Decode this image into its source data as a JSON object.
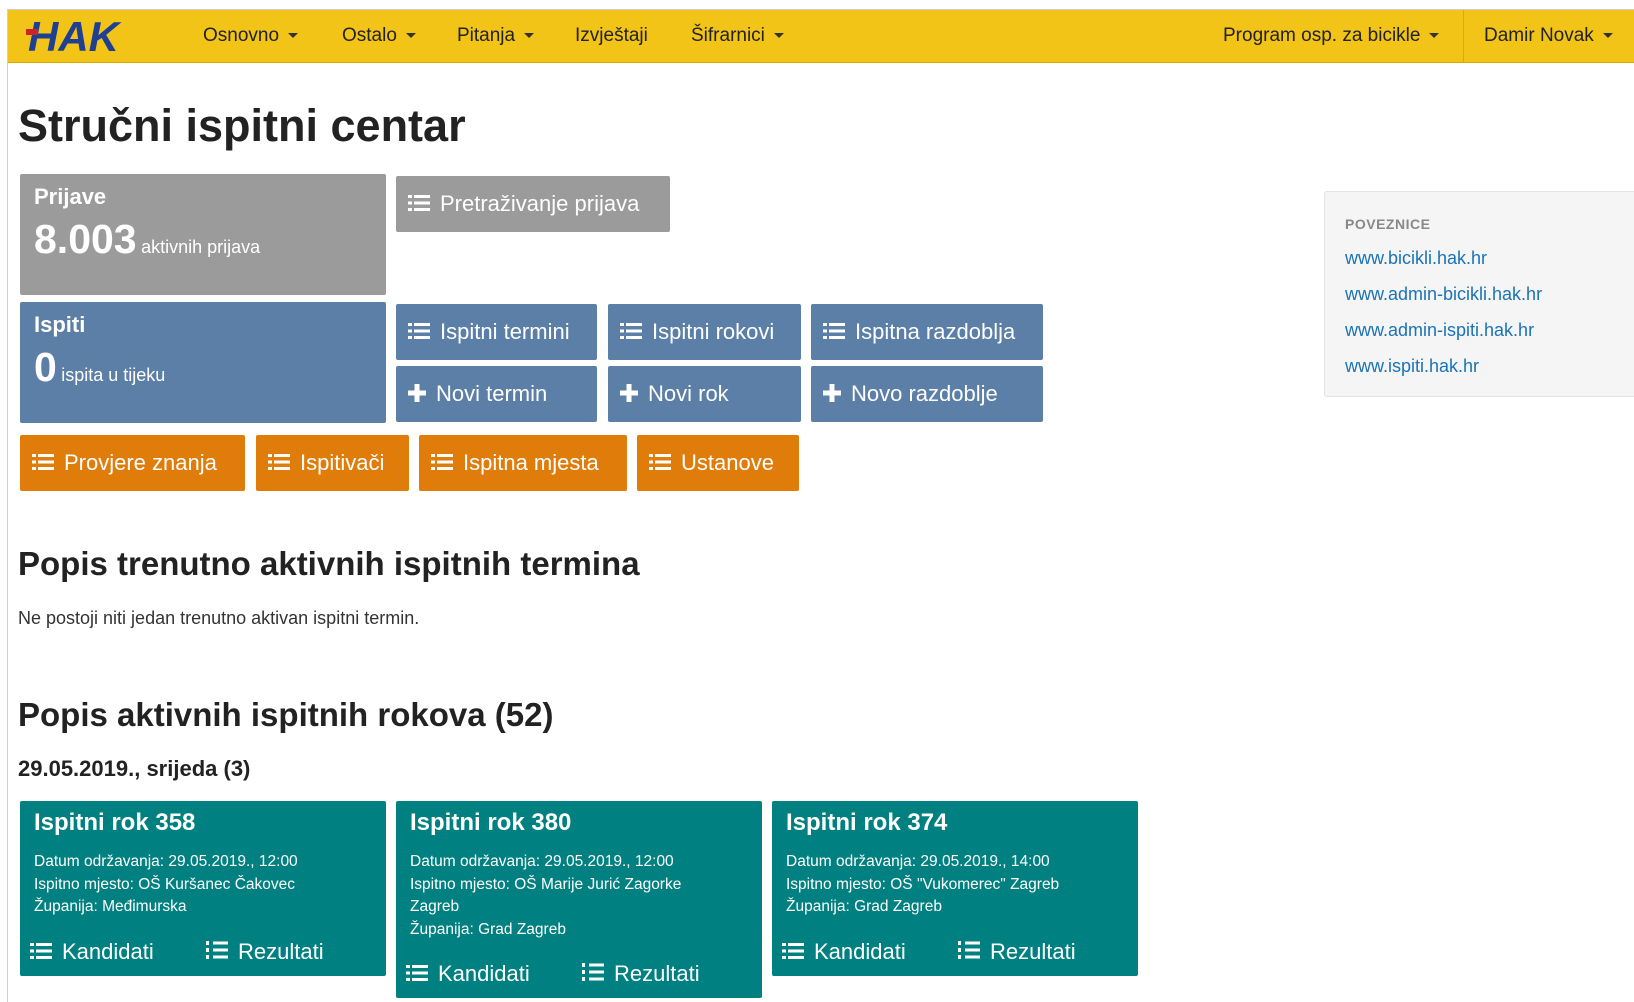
{
  "navbar": {
    "logo_text": "HAK",
    "items": [
      "Osnovno",
      "Ostalo",
      "Pitanja",
      "Izvještaji",
      "Šifrarnici"
    ],
    "right_program": "Program osp. za bicikle",
    "user": "Damir Novak"
  },
  "page_title": "Stručni ispitni centar",
  "prijave": {
    "title": "Prijave",
    "count": "8.003",
    "label": "aktivnih prijava"
  },
  "ispiti": {
    "title": "Ispiti",
    "count": "0",
    "label": "ispita u tijeku"
  },
  "buttons": {
    "pretrazivanje": "Pretraživanje prijava",
    "ispitni_termini": "Ispitni termini",
    "ispitni_rokovi": "Ispitni rokovi",
    "ispitna_razdoblja": "Ispitna razdoblja",
    "novi_termin": "Novi termin",
    "novi_rok": "Novi rok",
    "novo_razdoblje": "Novo razdoblje",
    "provjere_znanja": "Provjere znanja",
    "ispitivaci": "Ispitivači",
    "ispitna_mjesta": "Ispitna mjesta",
    "ustanove": "Ustanove"
  },
  "sidebar": {
    "header": "POVEZNICE",
    "links": [
      "www.bicikli.hak.hr",
      "www.admin-bicikli.hak.hr",
      "www.admin-ispiti.hak.hr",
      "www.ispiti.hak.hr"
    ]
  },
  "active_terms": {
    "heading": "Popis trenutno aktivnih ispitnih termina",
    "empty_note": "Ne postoji niti jedan trenutno aktivan ispitni termin."
  },
  "active_rokovi": {
    "heading": "Popis aktivnih ispitnih rokova (52)",
    "date_group": "29.05.2019., srijeda (3)",
    "cards": [
      {
        "title": "Ispitni rok 358",
        "datum": "Datum održavanja: 29.05.2019., 12:00",
        "mjesto": "Ispitno mjesto: OŠ Kuršanec Čakovec",
        "mjesto2": "",
        "zupanija": "Županija: Međimurska",
        "kandidati": "Kandidati",
        "rezultati": "Rezultati"
      },
      {
        "title": "Ispitni rok 380",
        "datum": "Datum održavanja: 29.05.2019., 12:00",
        "mjesto": "Ispitno mjesto: OŠ Marije Jurić Zagorke",
        "mjesto2": "Zagreb",
        "zupanija": "Županija: Grad Zagreb",
        "kandidati": "Kandidati",
        "rezultati": "Rezultati"
      },
      {
        "title": "Ispitni rok 374",
        "datum": "Datum održavanja: 29.05.2019., 14:00",
        "mjesto": "Ispitno mjesto: OŠ \"Vukomerec\" Zagreb",
        "mjesto2": "",
        "zupanija": "Županija: Grad Zagreb",
        "kandidati": "Kandidati",
        "rezultati": "Rezultati"
      }
    ]
  },
  "colors": {
    "navbar": "#f2c417",
    "gray_tile": "#9b9b9b",
    "steel_tile": "#5b7fa6",
    "orange_tile": "#e07c0a",
    "teal_card": "#008080",
    "link": "#1a73b8"
  }
}
